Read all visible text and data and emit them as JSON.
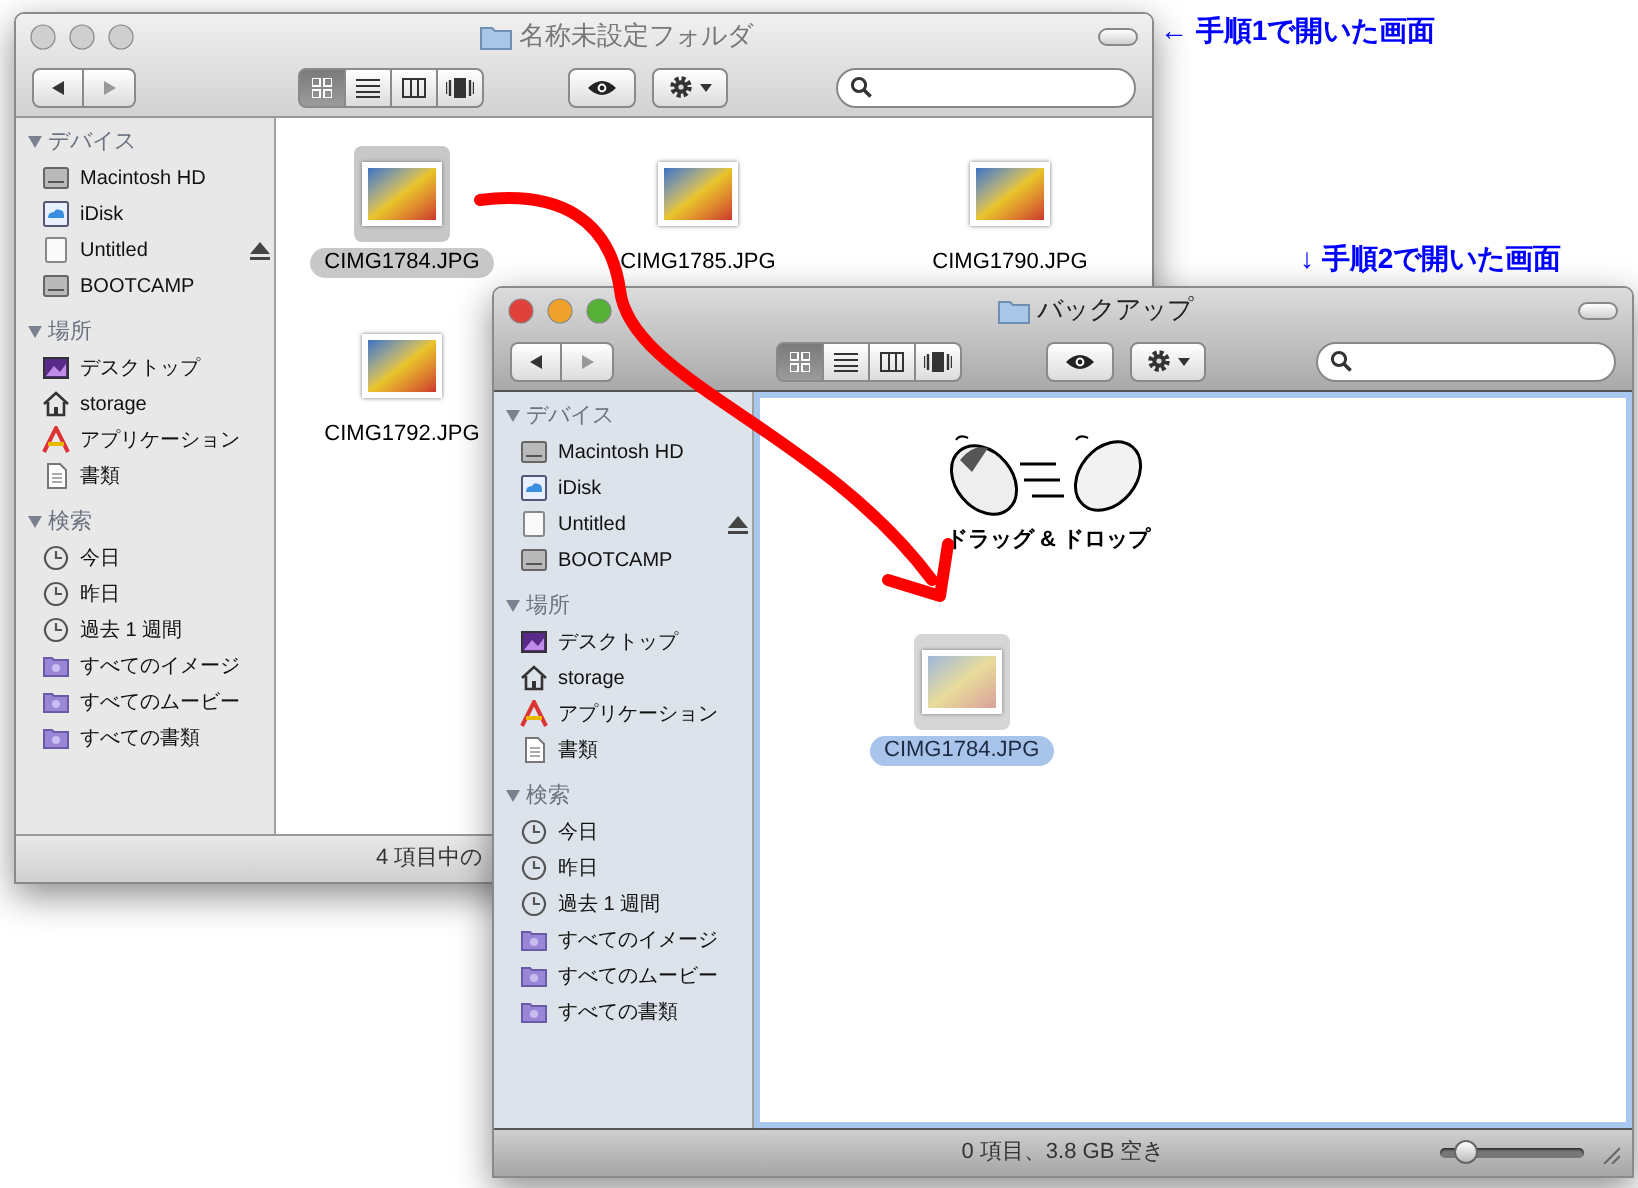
{
  "annotations": [
    {
      "text": "← 手順1で開いた画面"
    },
    {
      "text": "↓ 手順2で開いた画面"
    }
  ],
  "windows": [
    {
      "title": "名称未設定フォルダ",
      "active": false,
      "view_modes": [
        {
          "kind": "icon",
          "selected": true
        },
        {
          "kind": "list",
          "selected": false
        },
        {
          "kind": "column",
          "selected": false
        },
        {
          "kind": "coverflow",
          "selected": false
        }
      ],
      "sidebar": [
        {
          "heading": "デバイス",
          "children": [
            {
              "label": "Macintosh HD",
              "kind": "hd",
              "ejectable": false
            },
            {
              "label": "iDisk",
              "kind": "idisk",
              "ejectable": false
            },
            {
              "label": "Untitled",
              "kind": "volume",
              "ejectable": true
            },
            {
              "label": "BOOTCAMP",
              "kind": "hd",
              "ejectable": false
            }
          ]
        },
        {
          "heading": "場所",
          "children": [
            {
              "label": "デスクトップ",
              "kind": "desktop",
              "ejectable": false
            },
            {
              "label": "storage",
              "kind": "home",
              "ejectable": false
            },
            {
              "label": "アプリケーション",
              "kind": "apps",
              "ejectable": false
            },
            {
              "label": "書類",
              "kind": "docs",
              "ejectable": false
            }
          ]
        },
        {
          "heading": "検索",
          "children": [
            {
              "label": "今日",
              "kind": "clock",
              "ejectable": false
            },
            {
              "label": "昨日",
              "kind": "clock",
              "ejectable": false
            },
            {
              "label": "過去 1 週間",
              "kind": "clock",
              "ejectable": false
            },
            {
              "label": "すべてのイメージ",
              "kind": "smart",
              "ejectable": false
            },
            {
              "label": "すべてのムービー",
              "kind": "smart",
              "ejectable": false
            },
            {
              "label": "すべての書類",
              "kind": "smart",
              "ejectable": false
            }
          ]
        }
      ],
      "files": [
        {
          "name": "CIMG1784.JPG",
          "selected": true
        },
        {
          "name": "CIMG1785.JPG",
          "selected": false
        },
        {
          "name": "CIMG1790.JPG",
          "selected": false
        },
        {
          "name": "CIMG1792.JPG",
          "selected": false
        }
      ],
      "status": "4 項目中の"
    },
    {
      "title": "バックアップ",
      "active": true,
      "view_modes": [
        {
          "kind": "icon",
          "selected": true
        },
        {
          "kind": "list",
          "selected": false
        },
        {
          "kind": "column",
          "selected": false
        },
        {
          "kind": "coverflow",
          "selected": false
        }
      ],
      "sidebar": [
        {
          "heading": "デバイス",
          "children": [
            {
              "label": "Macintosh HD",
              "kind": "hd",
              "ejectable": false
            },
            {
              "label": "iDisk",
              "kind": "idisk",
              "ejectable": false
            },
            {
              "label": "Untitled",
              "kind": "volume",
              "ejectable": true
            },
            {
              "label": "BOOTCAMP",
              "kind": "hd",
              "ejectable": false
            }
          ]
        },
        {
          "heading": "場所",
          "children": [
            {
              "label": "デスクトップ",
              "kind": "desktop",
              "ejectable": false
            },
            {
              "label": "storage",
              "kind": "home",
              "ejectable": false
            },
            {
              "label": "アプリケーション",
              "kind": "apps",
              "ejectable": false
            },
            {
              "label": "書類",
              "kind": "docs",
              "ejectable": false
            }
          ]
        },
        {
          "heading": "検索",
          "children": [
            {
              "label": "今日",
              "kind": "clock",
              "ejectable": false
            },
            {
              "label": "昨日",
              "kind": "clock",
              "ejectable": false
            },
            {
              "label": "過去 1 週間",
              "kind": "clock",
              "ejectable": false
            },
            {
              "label": "すべてのイメージ",
              "kind": "smart",
              "ejectable": false
            },
            {
              "label": "すべてのムービー",
              "kind": "smart",
              "ejectable": false
            },
            {
              "label": "すべての書類",
              "kind": "smart",
              "ejectable": false
            }
          ]
        }
      ],
      "drag_label": "ドラッグ & ドロップ",
      "files": [
        {
          "name": "CIMG1784.JPG",
          "selected": true
        }
      ],
      "status": "0 項目、3.8 GB 空き",
      "icon_size_slider": {
        "level": 0.18
      }
    }
  ]
}
